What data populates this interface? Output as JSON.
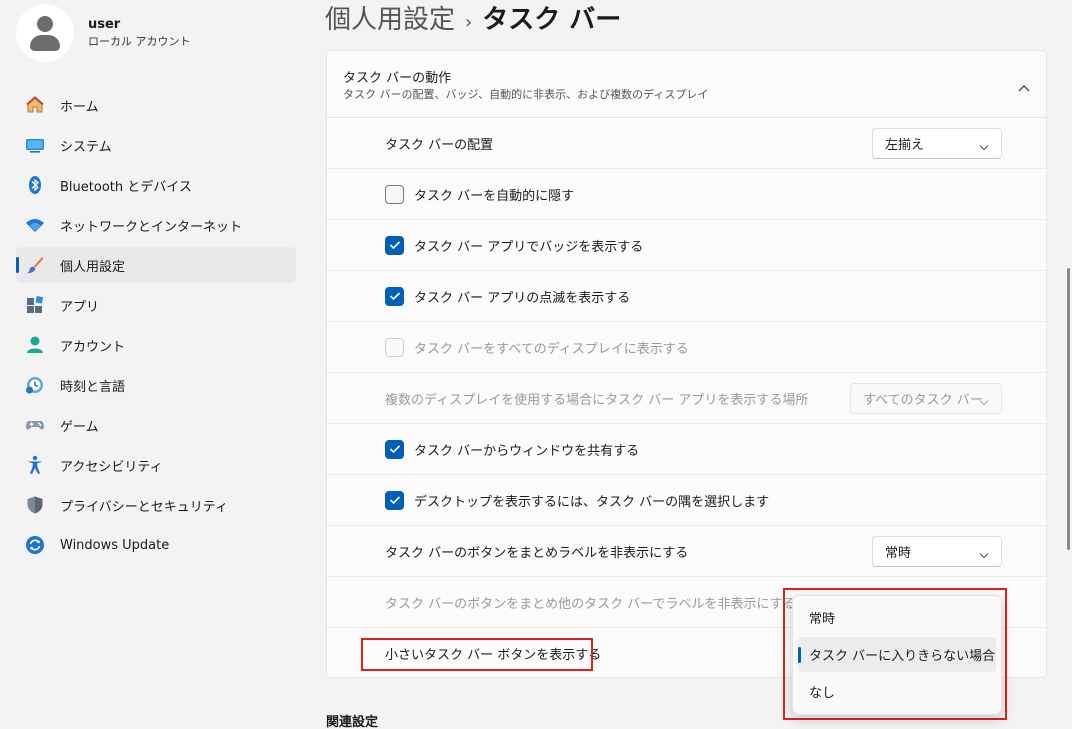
{
  "profile": {
    "name": "user",
    "account_type": "ローカル アカウント"
  },
  "sidebar": {
    "items": [
      {
        "label": "ホーム",
        "icon": "home-icon"
      },
      {
        "label": "システム",
        "icon": "system-icon"
      },
      {
        "label": "Bluetooth とデバイス",
        "icon": "bluetooth-icon"
      },
      {
        "label": "ネットワークとインターネット",
        "icon": "wifi-icon"
      },
      {
        "label": "個人用設定",
        "icon": "brush-icon",
        "selected": true
      },
      {
        "label": "アプリ",
        "icon": "apps-icon"
      },
      {
        "label": "アカウント",
        "icon": "account-icon"
      },
      {
        "label": "時刻と言語",
        "icon": "time-language-icon"
      },
      {
        "label": "ゲーム",
        "icon": "gamepad-icon"
      },
      {
        "label": "アクセシビリティ",
        "icon": "accessibility-icon"
      },
      {
        "label": "プライバシーとセキュリティ",
        "icon": "shield-icon"
      },
      {
        "label": "Windows Update",
        "icon": "update-icon"
      }
    ]
  },
  "header": {
    "parent": "個人用設定",
    "separator": "›",
    "current": "タスク バー"
  },
  "section": {
    "title": "タスク バーの動作",
    "subtitle": "タスク バーの配置、バッジ、自動的に非表示、および複数のディスプレイ"
  },
  "rows": {
    "alignment": {
      "label": "タスク バーの配置",
      "value": "左揃え"
    },
    "autohide": {
      "label": "タスク バーを自動的に隠す",
      "checked": false
    },
    "badges": {
      "label": "タスク バー アプリでバッジを表示する",
      "checked": true
    },
    "flashing": {
      "label": "タスク バー アプリの点滅を表示する",
      "checked": true
    },
    "all_displays": {
      "label": "タスク バーをすべてのディスプレイに表示する",
      "checked": false,
      "disabled": true
    },
    "multi_display": {
      "label": "複数のディスプレイを使用する場合にタスク バー アプリを表示する場所",
      "value": "すべてのタスク バー",
      "disabled": true
    },
    "share_window": {
      "label": "タスク バーからウィンドウを共有する",
      "checked": true
    },
    "desktop_corner": {
      "label": "デスクトップを表示するには、タスク バーの隅を選択します",
      "checked": true
    },
    "combine": {
      "label": "タスク バーのボタンをまとめラベルを非表示にする",
      "value": "常時"
    },
    "combine_other": {
      "label": "タスク バーのボタンをまとめ他のタスク バーでラベルを非表示にする",
      "disabled": true
    },
    "small_buttons": {
      "label": "小さいタスク バー ボタンを表示する"
    }
  },
  "dropdown": {
    "options": [
      "常時",
      "タスク バーに入りきらない場合",
      "なし"
    ],
    "selected_index": 1
  },
  "related": {
    "title": "関連設定"
  },
  "colors": {
    "accent": "#005fb8",
    "highlight": "#e02020"
  }
}
